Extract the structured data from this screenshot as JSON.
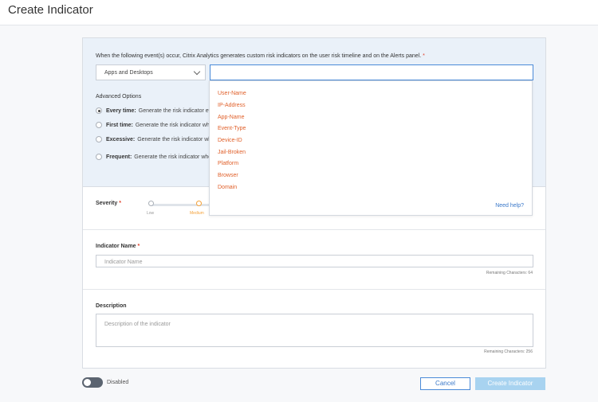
{
  "header": {
    "title": "Create Indicator"
  },
  "event_section": {
    "prompt": "When the following event(s) occur, Citrix Analytics generates custom risk indicators on the user risk timeline and on the Alerts panel.",
    "required_mark": "*",
    "source_select": {
      "value": "Apps and Desktops",
      "icon": "chevron-down-icon"
    },
    "value_input": {
      "value": ""
    },
    "advanced_title": "Advanced Options",
    "options": [
      {
        "label": "Every time:",
        "desc": "Generate the risk indicator ev",
        "checked": true
      },
      {
        "label": "First time:",
        "desc": "Generate the risk indicator whe",
        "checked": false
      },
      {
        "label": "Excessive:",
        "desc": "Generate the risk indicator whe",
        "checked": false
      },
      {
        "label": "Frequent:",
        "desc": "Generate the risk indicator whe",
        "checked": false
      }
    ]
  },
  "dropdown": {
    "items": [
      "User-Name",
      "IP-Address",
      "App-Name",
      "Event-Type",
      "Device-ID",
      "Jail-Broken",
      "Platform",
      "Browser",
      "Domain"
    ],
    "help_link": "Need help?"
  },
  "severity": {
    "label": "Severity",
    "required_mark": "*",
    "levels": [
      "Low",
      "Medium"
    ],
    "selected": "Medium"
  },
  "indicator_name": {
    "label": "Indicator Name",
    "required_mark": "*",
    "placeholder": "Indicator Name",
    "remaining": "Remaining Characters: 64"
  },
  "description": {
    "label": "Description",
    "placeholder": "Description of the indicator",
    "remaining": "Remaining Characters: 256"
  },
  "footer": {
    "toggle_label": "Disabled",
    "toggle_on": false,
    "cancel_label": "Cancel",
    "create_label": "Create Indicator"
  },
  "colors": {
    "accent": "#3a78c9",
    "required": "#e0402a",
    "dropdown_item": "#e0602a",
    "section_bg": "#eaf1f9",
    "create_disabled": "#a8d3f0"
  }
}
